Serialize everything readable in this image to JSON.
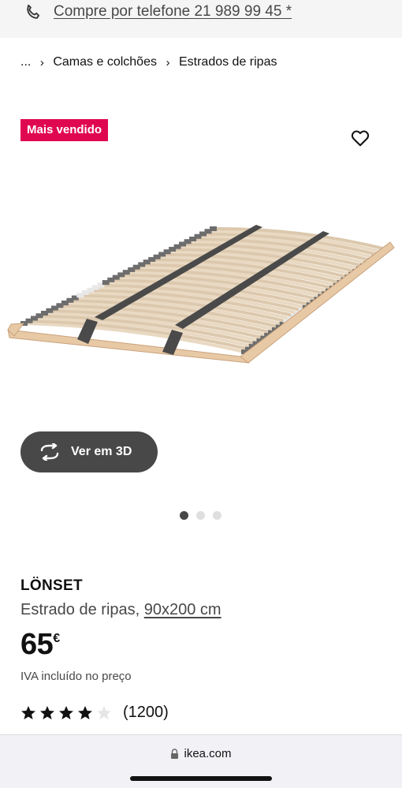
{
  "topbar": {
    "phone_label": "Compre por telefone 21 989 99 45 *",
    "icon": "phone-icon"
  },
  "breadcrumb": {
    "ellipsis": "...",
    "items": [
      "Camas e colchões",
      "Estrados de ripas"
    ]
  },
  "badge": {
    "label": "Mais vendido",
    "color": "#e00751"
  },
  "wishlist": {
    "icon": "heart-icon"
  },
  "view3d": {
    "label": "Ver em 3D",
    "icon": "rotate-3d-icon"
  },
  "carousel": {
    "total": 3,
    "active": 1
  },
  "product": {
    "name": "LÖNSET",
    "description": "Estrado de ripas, ",
    "size": "90x200 cm",
    "price": "65",
    "currency": "€",
    "vat_note": "IVA incluído no preço"
  },
  "rating": {
    "value": 4,
    "max": 5,
    "count": "(1200)"
  },
  "browser": {
    "url": "ikea.com",
    "icon": "lock-icon"
  }
}
